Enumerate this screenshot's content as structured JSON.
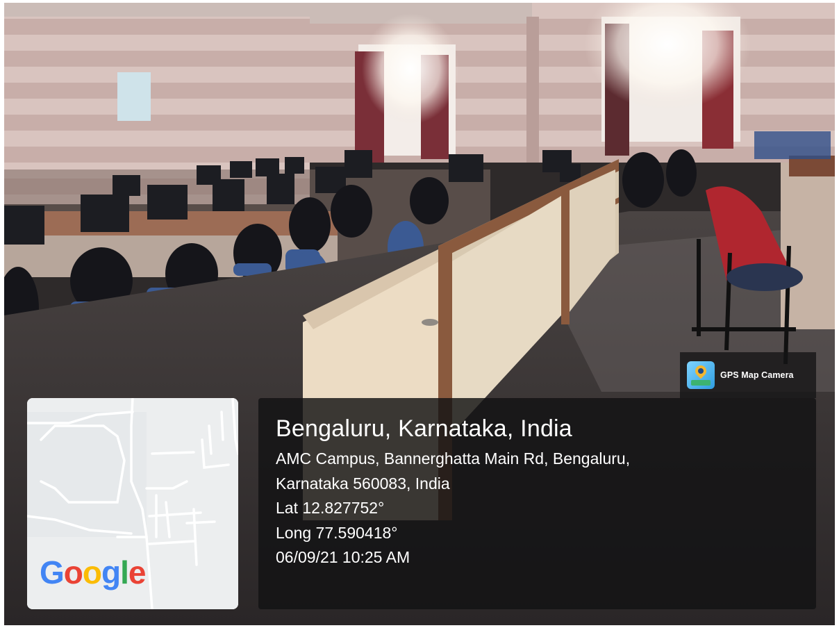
{
  "badge": {
    "app_icon": "gps-map-camera-icon",
    "label": "GPS Map Camera"
  },
  "map": {
    "logo_text": [
      "G",
      "o",
      "o",
      "g",
      "l",
      "e"
    ],
    "logo_colors": [
      "#4285F4",
      "#EA4335",
      "#FBBC05",
      "#4285F4",
      "#34A853",
      "#EA4335"
    ],
    "background_color": "#eceeef"
  },
  "location": {
    "city_line": "Bengaluru, Karnataka, India",
    "address_line_1": "AMC Campus, Bannerghatta Main Rd, Bengaluru,",
    "address_line_2": "Karnataka 560083, India",
    "latitude": "Lat 12.827752°",
    "longitude": "Long 77.590418°",
    "timestamp": "06/09/21 10:25 AM"
  }
}
